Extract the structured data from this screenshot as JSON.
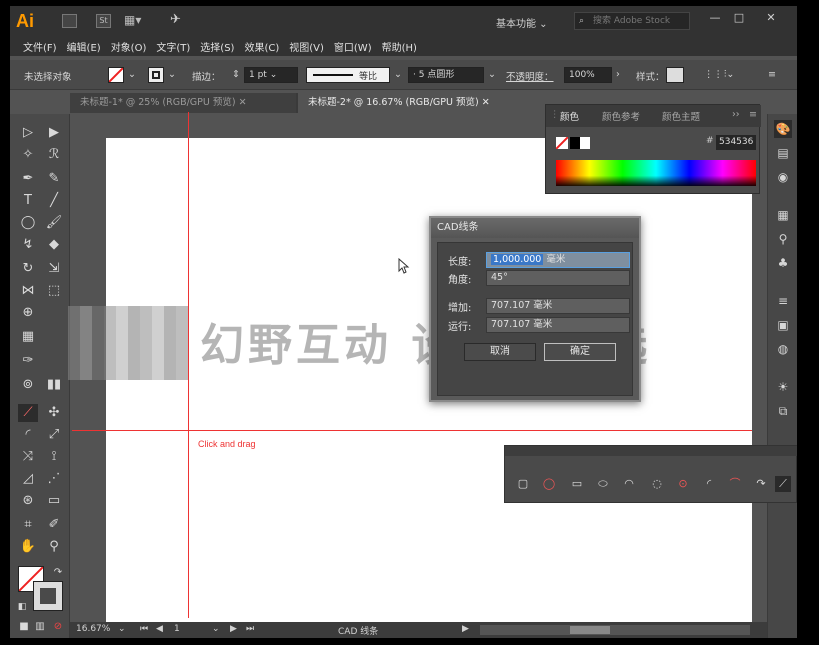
{
  "titlebar": {
    "app_logo": "Ai",
    "stock_icon": "St",
    "workspace": "基本功能",
    "search_placeholder": "搜索 Adobe Stock",
    "minimize": "—",
    "maximize": "□",
    "close": "✕"
  },
  "menu": [
    "文件(F)",
    "编辑(E)",
    "对象(O)",
    "文字(T)",
    "选择(S)",
    "效果(C)",
    "视图(V)",
    "窗口(W)",
    "帮助(H)"
  ],
  "control_bar": {
    "selection_status": "未选择对象",
    "stroke_label": "描边：",
    "stroke_weight": "1 pt",
    "stroke_profile": "等比",
    "brush": "5 点圆形",
    "opacity_label": "不透明度：",
    "opacity_value": "100%",
    "style_label": "样式："
  },
  "doc_tabs": [
    {
      "label": "未标题-1* @ 25% (RGB/GPU 预览)",
      "active": false
    },
    {
      "label": "未标题-2* @ 16.67% (RGB/GPU 预览)",
      "active": true
    }
  ],
  "color_panel": {
    "tabs": [
      "颜色",
      "颜色参考",
      "颜色主题"
    ],
    "hex_value": "534536"
  },
  "dialog": {
    "title": "CAD线条",
    "length_label": "长度:",
    "length_value": "1,000.000",
    "length_unit": "毫米",
    "angle_label": "角度:",
    "angle_value": "45°",
    "increase_label": "增加:",
    "increase_value": "707.107 毫米",
    "run_label": "运行:",
    "run_value": "707.107 毫米",
    "cancel": "取消",
    "ok": "确定"
  },
  "canvas": {
    "hint": "Click and drag",
    "watermark": "幻野互动 设计师精选"
  },
  "status_bar": {
    "zoom": "16.67%",
    "artboard_number": "1",
    "current_tool": "CAD 线条"
  }
}
